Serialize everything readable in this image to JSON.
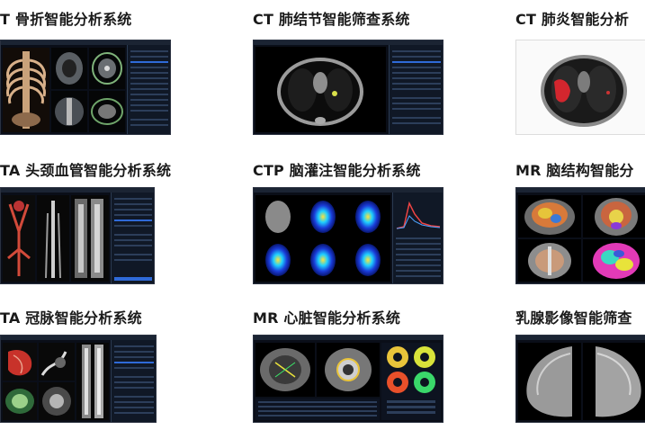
{
  "products": [
    {
      "title": "T 骨折智能分析系统"
    },
    {
      "title": "CT 肺结节智能筛查系统"
    },
    {
      "title": "CT 肺炎智能分析"
    },
    {
      "title": "TA 头颈血管智能分析系统"
    },
    {
      "title": "CTP 脑灌注智能分析系统"
    },
    {
      "title": "MR 脑结构智能分"
    },
    {
      "title": "TA 冠脉智能分析系统"
    },
    {
      "title": "MR 心脏智能分析系统"
    },
    {
      "title": "乳腺影像智能筛查"
    }
  ]
}
